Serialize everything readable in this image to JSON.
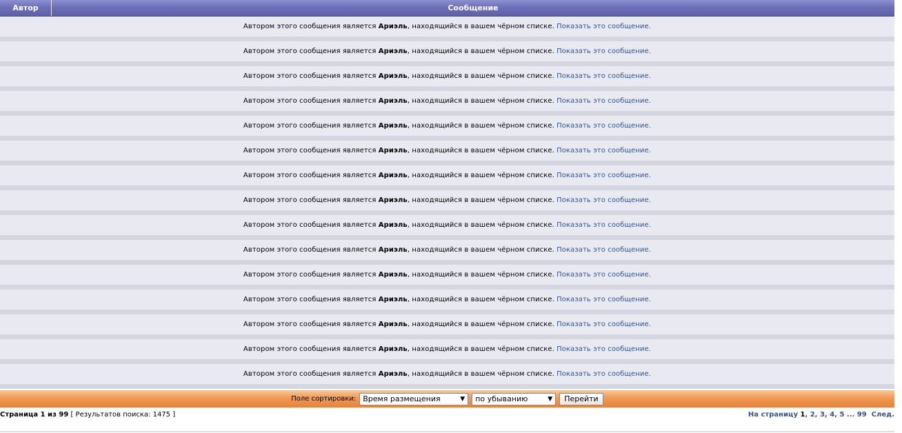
{
  "table": {
    "header_author": "Автор",
    "header_message": "Сообщение"
  },
  "rows": [
    {
      "pre": "Автором этого сообщения является ",
      "author": "Ариэль",
      "mid": ", находящийся в вашем чёрном списке. ",
      "link": "Показать это сообщение."
    },
    {
      "pre": "Автором этого сообщения является ",
      "author": "Ариэль",
      "mid": ", находящийся в вашем чёрном списке. ",
      "link": "Показать это сообщение."
    },
    {
      "pre": "Автором этого сообщения является ",
      "author": "Ариэль",
      "mid": ", находящийся в вашем чёрном списке. ",
      "link": "Показать это сообщение."
    },
    {
      "pre": "Автором этого сообщения является ",
      "author": "Ариэль",
      "mid": ", находящийся в вашем чёрном списке. ",
      "link": "Показать это сообщение."
    },
    {
      "pre": "Автором этого сообщения является ",
      "author": "Ариэль",
      "mid": ", находящийся в вашем чёрном списке. ",
      "link": "Показать это сообщение."
    },
    {
      "pre": "Автором этого сообщения является ",
      "author": "Ариэль",
      "mid": ", находящийся в вашем чёрном списке. ",
      "link": "Показать это сообщение."
    },
    {
      "pre": "Автором этого сообщения является ",
      "author": "Ариэль",
      "mid": ", находящийся в вашем чёрном списке. ",
      "link": "Показать это сообщение."
    },
    {
      "pre": "Автором этого сообщения является ",
      "author": "Ариэль",
      "mid": ", находящийся в вашем чёрном списке. ",
      "link": "Показать это сообщение."
    },
    {
      "pre": "Автором этого сообщения является ",
      "author": "Ариэль",
      "mid": ", находящийся в вашем чёрном списке. ",
      "link": "Показать это сообщение."
    },
    {
      "pre": "Автором этого сообщения является ",
      "author": "Ариэль",
      "mid": ", находящийся в вашем чёрном списке. ",
      "link": "Показать это сообщение."
    },
    {
      "pre": "Автором этого сообщения является ",
      "author": "Ариэль",
      "mid": ", находящийся в вашем чёрном списке. ",
      "link": "Показать это сообщение."
    },
    {
      "pre": "Автором этого сообщения является ",
      "author": "Ариэль",
      "mid": ", находящийся в вашем чёрном списке. ",
      "link": "Показать это сообщение."
    },
    {
      "pre": "Автором этого сообщения является ",
      "author": "Ариэль",
      "mid": ", находящийся в вашем чёрном списке. ",
      "link": "Показать это сообщение."
    },
    {
      "pre": "Автором этого сообщения является ",
      "author": "Ариэль",
      "mid": ", находящийся в вашем чёрном списке. ",
      "link": "Показать это сообщение."
    },
    {
      "pre": "Автором этого сообщения является ",
      "author": "Ариэль",
      "mid": ", находящийся в вашем чёрном списке. ",
      "link": "Показать это сообщение."
    }
  ],
  "sort": {
    "label": "Поле сортировки:",
    "field_value": "Время размещения",
    "order_value": "по убыванию",
    "go_label": "Перейти"
  },
  "footer": {
    "page_prefix": "Страница ",
    "page_current": "1",
    "page_of": " из ",
    "page_total": "99",
    "results": " [ Результатов поиска: 1475 ]",
    "nav_prefix": "На страницу ",
    "pages": [
      "1",
      "2",
      "3",
      "4",
      "5"
    ],
    "ellipsis": " ... ",
    "last_page": "99",
    "next": "След."
  },
  "colors": {
    "header": "#6d70b8",
    "row_bg": "#e8e9f1",
    "row_sep": "#d4d6e2",
    "link": "#34538a",
    "sortbar": "#f09a55"
  }
}
